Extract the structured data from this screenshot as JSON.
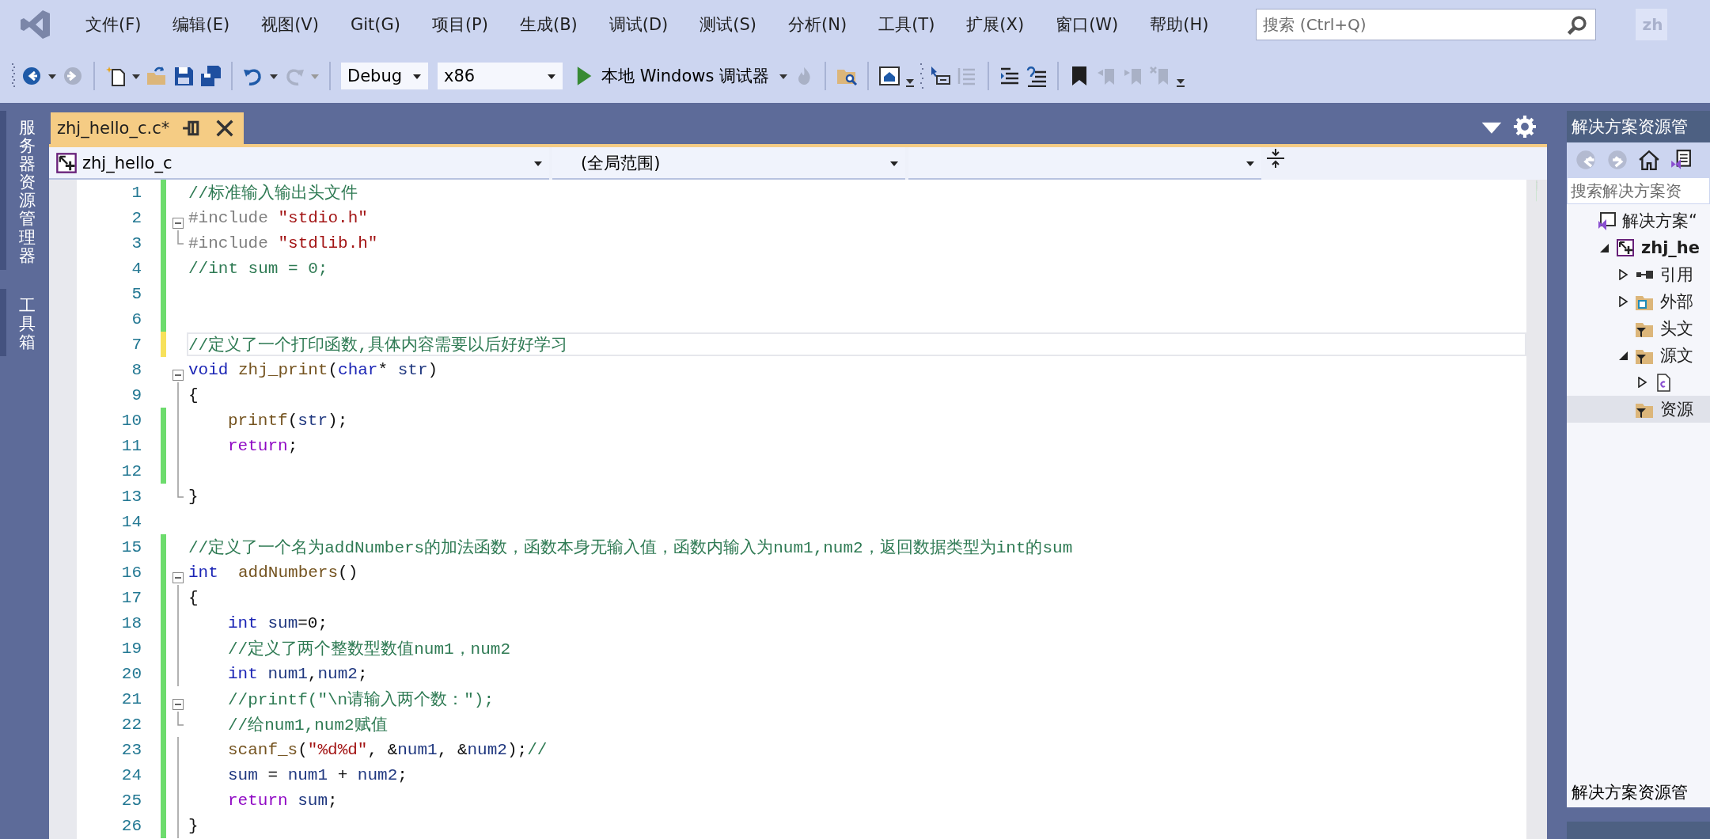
{
  "menu": [
    {
      "label": "文件(F)"
    },
    {
      "label": "编辑(E)"
    },
    {
      "label": "视图(V)"
    },
    {
      "label": "Git(G)"
    },
    {
      "label": "项目(P)"
    },
    {
      "label": "生成(B)"
    },
    {
      "label": "调试(D)"
    },
    {
      "label": "测试(S)"
    },
    {
      "label": "分析(N)"
    },
    {
      "label": "工具(T)"
    },
    {
      "label": "扩展(X)"
    },
    {
      "label": "窗口(W)"
    },
    {
      "label": "帮助(H)"
    }
  ],
  "search": {
    "placeholder": "搜索 (Ctrl+Q)"
  },
  "account": {
    "label": "zh"
  },
  "toolbar": {
    "icons": [
      {
        "disabled": false
      },
      {
        "disabled": true
      },
      {
        "disabled": false
      },
      {
        "disabled": false
      },
      {
        "disabled": false
      },
      {
        "disabled": false
      },
      {
        "disabled": false
      },
      {
        "disabled": true
      }
    ],
    "configuration": "Debug",
    "platform": "x86",
    "run_label": "本地 Windows 调试器",
    "icons2": [
      {
        "disabled": true
      },
      {
        "disabled": false
      },
      {
        "disabled": false
      },
      {
        "disabled": false
      },
      {
        "disabled": true
      },
      {
        "disabled": false
      },
      {
        "disabled": false
      },
      {
        "disabled": false
      },
      {
        "disabled": true
      },
      {
        "disabled": true
      },
      {
        "disabled": true
      }
    ]
  },
  "side_tabs": [
    {
      "label": "服务器资源管理器"
    },
    {
      "label": "工具箱"
    }
  ],
  "editor": {
    "tabs": [
      {
        "label": "zhj_hello_c.c*",
        "selected": true
      }
    ],
    "nav": {
      "project": "zhj_hello_c",
      "scope": "(全局范围)"
    },
    "lines": [
      {
        "number": "1",
        "marker": {
          "color": "#6ddc6d"
        },
        "collapsible": false,
        "in_block": false,
        "block_end": false,
        "current": false,
        "indented": false,
        "code": [
          {
            "kind": "comment",
            "text": "//标准输入输出头文件"
          }
        ]
      },
      {
        "number": "2",
        "marker": {
          "color": "#6ddc6d"
        },
        "collapsible": true,
        "in_block": false,
        "block_end": false,
        "current": false,
        "indented": false,
        "code": [
          {
            "kind": "pre",
            "text": "#include "
          },
          {
            "kind": "str",
            "text": "\"stdio.h\""
          }
        ]
      },
      {
        "number": "3",
        "marker": {
          "color": "#6ddc6d"
        },
        "collapsible": false,
        "in_block": false,
        "block_end": true,
        "current": false,
        "indented": false,
        "code": [
          {
            "kind": "pre",
            "text": "#include "
          },
          {
            "kind": "str",
            "text": "\"stdlib.h\""
          }
        ]
      },
      {
        "number": "4",
        "marker": {
          "color": "#6ddc6d"
        },
        "collapsible": false,
        "in_block": false,
        "block_end": false,
        "current": false,
        "indented": false,
        "code": [
          {
            "kind": "comment",
            "text": "//int sum = 0;"
          }
        ]
      },
      {
        "number": "5",
        "marker": {
          "color": "#6ddc6d"
        },
        "collapsible": false,
        "in_block": false,
        "block_end": false,
        "current": false,
        "indented": false
      },
      {
        "number": "6",
        "marker": {
          "color": "#6ddc6d"
        },
        "collapsible": false,
        "in_block": false,
        "block_end": false,
        "current": false,
        "indented": false
      },
      {
        "number": "7",
        "marker": {
          "color": "#f7e15b"
        },
        "collapsible": false,
        "in_block": false,
        "block_end": false,
        "current": true,
        "indented": false,
        "code": [
          {
            "kind": "comment",
            "text": "//定义了一个打印函数,具体内容需要以后好好学习"
          }
        ]
      },
      {
        "number": "8",
        "collapsible": true,
        "in_block": false,
        "block_end": false,
        "current": false,
        "indented": false,
        "code": [
          {
            "kind": "kw",
            "text": "void "
          },
          {
            "kind": "func",
            "text": "zhj_print"
          },
          {
            "kind": "plain",
            "text": "("
          },
          {
            "kind": "kw",
            "text": "char"
          },
          {
            "kind": "plain",
            "text": "* "
          },
          {
            "kind": "var",
            "text": "str"
          },
          {
            "kind": "plain",
            "text": ")"
          }
        ]
      },
      {
        "number": "9",
        "collapsible": false,
        "in_block": true,
        "block_end": false,
        "current": false,
        "indented": false,
        "code": [
          {
            "kind": "plain",
            "text": "{"
          }
        ]
      },
      {
        "number": "10",
        "marker": {
          "color": "#6ddc6d"
        },
        "collapsible": false,
        "in_block": true,
        "block_end": false,
        "current": false,
        "indented": true,
        "code": [
          {
            "kind": "func",
            "text": "printf"
          },
          {
            "kind": "plain",
            "text": "("
          },
          {
            "kind": "var",
            "text": "str"
          },
          {
            "kind": "plain",
            "text": ");"
          }
        ]
      },
      {
        "number": "11",
        "marker": {
          "color": "#6ddc6d"
        },
        "collapsible": false,
        "in_block": true,
        "block_end": false,
        "current": false,
        "indented": true,
        "code": [
          {
            "kind": "ctrl",
            "text": "return"
          },
          {
            "kind": "plain",
            "text": ";"
          }
        ]
      },
      {
        "number": "12",
        "marker": {
          "color": "#6ddc6d"
        },
        "collapsible": false,
        "in_block": true,
        "block_end": false,
        "current": false,
        "indented": false
      },
      {
        "number": "13",
        "collapsible": false,
        "in_block": false,
        "block_end": true,
        "current": false,
        "indented": false,
        "code": [
          {
            "kind": "plain",
            "text": "}"
          }
        ]
      },
      {
        "number": "14",
        "collapsible": false,
        "in_block": false,
        "block_end": false,
        "current": false,
        "indented": false
      },
      {
        "number": "15",
        "marker": {
          "color": "#6ddc6d"
        },
        "collapsible": false,
        "in_block": false,
        "block_end": false,
        "current": false,
        "indented": false,
        "code": [
          {
            "kind": "comment",
            "text": "//定义了一个名为addNumbers的加法函数，函数本身无输入值，函数内输入为num1,num2，返回数据类型为int的sum"
          }
        ]
      },
      {
        "number": "16",
        "marker": {
          "color": "#6ddc6d"
        },
        "collapsible": true,
        "in_block": false,
        "block_end": false,
        "current": false,
        "indented": false,
        "code": [
          {
            "kind": "kw",
            "text": "int  "
          },
          {
            "kind": "func",
            "text": "addNumbers"
          },
          {
            "kind": "plain",
            "text": "()"
          }
        ]
      },
      {
        "number": "17",
        "marker": {
          "color": "#6ddc6d"
        },
        "collapsible": false,
        "in_block": true,
        "block_end": false,
        "current": false,
        "indented": false,
        "code": [
          {
            "kind": "plain",
            "text": "{"
          }
        ]
      },
      {
        "number": "18",
        "marker": {
          "color": "#6ddc6d"
        },
        "collapsible": false,
        "in_block": true,
        "block_end": false,
        "current": false,
        "indented": true,
        "code": [
          {
            "kind": "kw",
            "text": "int "
          },
          {
            "kind": "var",
            "text": "sum"
          },
          {
            "kind": "plain",
            "text": "=0;"
          }
        ]
      },
      {
        "number": "19",
        "marker": {
          "color": "#6ddc6d"
        },
        "collapsible": false,
        "in_block": true,
        "block_end": false,
        "current": false,
        "indented": true,
        "code": [
          {
            "kind": "comment",
            "text": "//定义了两个整数型数值num1，num2"
          }
        ]
      },
      {
        "number": "20",
        "marker": {
          "color": "#6ddc6d"
        },
        "collapsible": false,
        "in_block": true,
        "block_end": false,
        "current": false,
        "indented": true,
        "code": [
          {
            "kind": "kw",
            "text": "int "
          },
          {
            "kind": "var",
            "text": "num1"
          },
          {
            "kind": "plain",
            "text": ","
          },
          {
            "kind": "var",
            "text": "num2"
          },
          {
            "kind": "plain",
            "text": ";"
          }
        ]
      },
      {
        "number": "21",
        "marker": {
          "color": "#6ddc6d"
        },
        "collapsible": true,
        "in_block": false,
        "block_end": false,
        "current": false,
        "indented": true,
        "code": [
          {
            "kind": "comment",
            "text": "//printf(\"\\n请输入两个数：\");"
          }
        ]
      },
      {
        "number": "22",
        "marker": {
          "color": "#6ddc6d"
        },
        "collapsible": false,
        "in_block": false,
        "block_end": true,
        "current": false,
        "indented": true,
        "code": [
          {
            "kind": "comment",
            "text": "//给num1,num2赋值"
          }
        ]
      },
      {
        "number": "23",
        "marker": {
          "color": "#6ddc6d"
        },
        "collapsible": false,
        "in_block": true,
        "block_end": false,
        "current": false,
        "indented": true,
        "code": [
          {
            "kind": "func",
            "text": "scanf_s"
          },
          {
            "kind": "plain",
            "text": "("
          },
          {
            "kind": "str",
            "text": "\"%d%d\""
          },
          {
            "kind": "plain",
            "text": ", &"
          },
          {
            "kind": "var",
            "text": "num1"
          },
          {
            "kind": "plain",
            "text": ", &"
          },
          {
            "kind": "var",
            "text": "num2"
          },
          {
            "kind": "plain",
            "text": ");"
          },
          {
            "kind": "comment",
            "text": "//"
          }
        ]
      },
      {
        "number": "24",
        "marker": {
          "color": "#6ddc6d"
        },
        "collapsible": false,
        "in_block": true,
        "block_end": false,
        "current": false,
        "indented": true,
        "code": [
          {
            "kind": "var",
            "text": "sum"
          },
          {
            "kind": "plain",
            "text": " = "
          },
          {
            "kind": "var",
            "text": "num1"
          },
          {
            "kind": "plain",
            "text": " + "
          },
          {
            "kind": "var",
            "text": "num2"
          },
          {
            "kind": "plain",
            "text": ";"
          }
        ]
      },
      {
        "number": "25",
        "marker": {
          "color": "#6ddc6d"
        },
        "collapsible": false,
        "in_block": true,
        "block_end": false,
        "current": false,
        "indented": true,
        "code": [
          {
            "kind": "ctrl",
            "text": "return "
          },
          {
            "kind": "var",
            "text": "sum"
          },
          {
            "kind": "plain",
            "text": ";"
          }
        ]
      },
      {
        "number": "26",
        "marker": {
          "color": "#6ddc6d"
        },
        "collapsible": false,
        "in_block": true,
        "block_end": false,
        "current": false,
        "indented": false,
        "code": [
          {
            "kind": "plain",
            "text": "}"
          }
        ]
      }
    ]
  },
  "solution_explorer": {
    "title": "解决方案资源管",
    "search": {
      "placeholder": "搜索解决方案资"
    },
    "tree": [
      {
        "label": "解决方案“",
        "kind": "solution",
        "selected": false,
        "children": [
          {
            "label": "zhj_he",
            "kind": "project",
            "expanded": true,
            "selected": false,
            "children": [
              {
                "label": "引用",
                "kind": "references",
                "expanded": false,
                "selected": false
              },
              {
                "label": "外部",
                "kind": "external",
                "expanded": false,
                "selected": false
              },
              {
                "label": "头文",
                "kind": "filter",
                "selected": false
              },
              {
                "label": "源文",
                "kind": "filter",
                "expanded": true,
                "selected": false,
                "children": [
                  {
                    "kind": "cfile",
                    "expanded": false,
                    "selected": false
                  }
                ]
              },
              {
                "label": "资源",
                "kind": "filter",
                "selected": true
              }
            ]
          }
        ]
      }
    ],
    "bottom_tab": "解决方案资源管"
  }
}
